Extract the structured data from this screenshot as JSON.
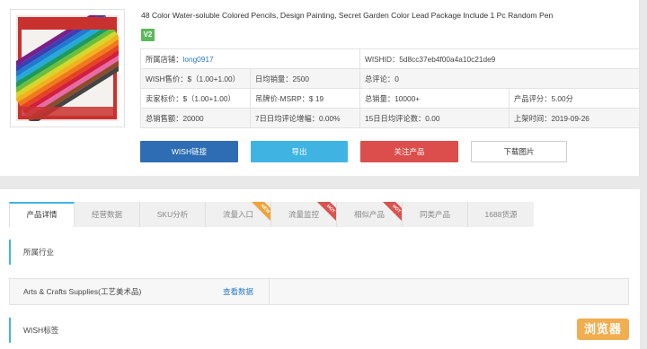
{
  "product": {
    "title": "48 Color Water-soluble Colored Pencils, Design Painting, Secret Garden Color Lead Package Include 1 Pc Random Pen",
    "badge": "V2",
    "image_icon": "colored-pencil-box-image"
  },
  "info": {
    "store_label": "所属店铺：",
    "store_value": "long0917",
    "wishid": "WISHID：5d8cc37eb4f00a4a10c21de9",
    "wish_price": "WISH售价：$（1.00+1.00）",
    "avg_daily_sales": "日均销量：2500",
    "total_reviews": "总评论：0",
    "seller_price": "卖家标价：$（1.00+1.00）",
    "msrp": "吊牌价-MSRP：$ 19",
    "total_sales": "总销量：10000+",
    "rating": "产品评分：5.00分",
    "total_revenue": "总销售额：20000",
    "review_growth_7d": "7日日均评论增幅：0.00%",
    "daily_reviews_15d": "15日日均评论数：0.00",
    "listed_date": "上架时间：2019-09-26"
  },
  "actions": {
    "wish_link": "WISH链接",
    "export": "导出",
    "follow": "关注产品",
    "download": "下载图片"
  },
  "tabs": [
    {
      "label": "产品详情",
      "ribbon": ""
    },
    {
      "label": "经营数据",
      "ribbon": ""
    },
    {
      "label": "SKU分析",
      "ribbon": ""
    },
    {
      "label": "流量入口",
      "ribbon": "NEW"
    },
    {
      "label": "流量监控",
      "ribbon": "HOT"
    },
    {
      "label": "相似产品",
      "ribbon": "HOT"
    },
    {
      "label": "同类产品",
      "ribbon": ""
    },
    {
      "label": "1688货源",
      "ribbon": ""
    }
  ],
  "sections": {
    "industry_title": "所属行业",
    "industry_name": "Arts & Crafts Supplies(工艺美术品)",
    "industry_link": "查看数据",
    "wish_tags_title": "WISH标签"
  },
  "watermark": "浏览器",
  "colors": {
    "accent": "#3fb4e3",
    "wish_button": "#2e6db4",
    "follow_button": "#dc4e4c",
    "badge": "#5cb85c",
    "link": "#2a7ac0"
  }
}
